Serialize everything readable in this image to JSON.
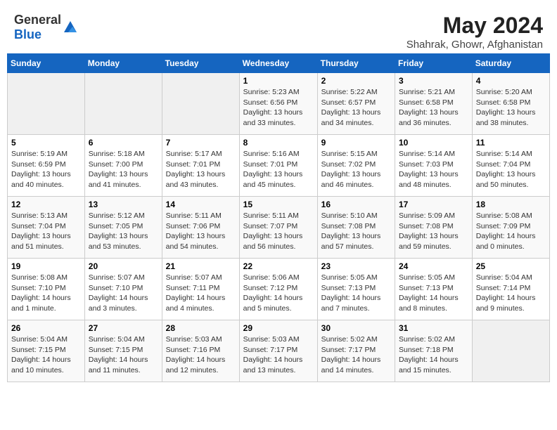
{
  "header": {
    "logo_general": "General",
    "logo_blue": "Blue",
    "month_year": "May 2024",
    "location": "Shahrak, Ghowr, Afghanistan"
  },
  "days_of_week": [
    "Sunday",
    "Monday",
    "Tuesday",
    "Wednesday",
    "Thursday",
    "Friday",
    "Saturday"
  ],
  "weeks": [
    [
      {
        "day": "",
        "sunrise": "",
        "sunset": "",
        "daylight": ""
      },
      {
        "day": "",
        "sunrise": "",
        "sunset": "",
        "daylight": ""
      },
      {
        "day": "",
        "sunrise": "",
        "sunset": "",
        "daylight": ""
      },
      {
        "day": "1",
        "sunrise": "Sunrise: 5:23 AM",
        "sunset": "Sunset: 6:56 PM",
        "daylight": "Daylight: 13 hours and 33 minutes."
      },
      {
        "day": "2",
        "sunrise": "Sunrise: 5:22 AM",
        "sunset": "Sunset: 6:57 PM",
        "daylight": "Daylight: 13 hours and 34 minutes."
      },
      {
        "day": "3",
        "sunrise": "Sunrise: 5:21 AM",
        "sunset": "Sunset: 6:58 PM",
        "daylight": "Daylight: 13 hours and 36 minutes."
      },
      {
        "day": "4",
        "sunrise": "Sunrise: 5:20 AM",
        "sunset": "Sunset: 6:58 PM",
        "daylight": "Daylight: 13 hours and 38 minutes."
      }
    ],
    [
      {
        "day": "5",
        "sunrise": "Sunrise: 5:19 AM",
        "sunset": "Sunset: 6:59 PM",
        "daylight": "Daylight: 13 hours and 40 minutes."
      },
      {
        "day": "6",
        "sunrise": "Sunrise: 5:18 AM",
        "sunset": "Sunset: 7:00 PM",
        "daylight": "Daylight: 13 hours and 41 minutes."
      },
      {
        "day": "7",
        "sunrise": "Sunrise: 5:17 AM",
        "sunset": "Sunset: 7:01 PM",
        "daylight": "Daylight: 13 hours and 43 minutes."
      },
      {
        "day": "8",
        "sunrise": "Sunrise: 5:16 AM",
        "sunset": "Sunset: 7:01 PM",
        "daylight": "Daylight: 13 hours and 45 minutes."
      },
      {
        "day": "9",
        "sunrise": "Sunrise: 5:15 AM",
        "sunset": "Sunset: 7:02 PM",
        "daylight": "Daylight: 13 hours and 46 minutes."
      },
      {
        "day": "10",
        "sunrise": "Sunrise: 5:14 AM",
        "sunset": "Sunset: 7:03 PM",
        "daylight": "Daylight: 13 hours and 48 minutes."
      },
      {
        "day": "11",
        "sunrise": "Sunrise: 5:14 AM",
        "sunset": "Sunset: 7:04 PM",
        "daylight": "Daylight: 13 hours and 50 minutes."
      }
    ],
    [
      {
        "day": "12",
        "sunrise": "Sunrise: 5:13 AM",
        "sunset": "Sunset: 7:04 PM",
        "daylight": "Daylight: 13 hours and 51 minutes."
      },
      {
        "day": "13",
        "sunrise": "Sunrise: 5:12 AM",
        "sunset": "Sunset: 7:05 PM",
        "daylight": "Daylight: 13 hours and 53 minutes."
      },
      {
        "day": "14",
        "sunrise": "Sunrise: 5:11 AM",
        "sunset": "Sunset: 7:06 PM",
        "daylight": "Daylight: 13 hours and 54 minutes."
      },
      {
        "day": "15",
        "sunrise": "Sunrise: 5:11 AM",
        "sunset": "Sunset: 7:07 PM",
        "daylight": "Daylight: 13 hours and 56 minutes."
      },
      {
        "day": "16",
        "sunrise": "Sunrise: 5:10 AM",
        "sunset": "Sunset: 7:08 PM",
        "daylight": "Daylight: 13 hours and 57 minutes."
      },
      {
        "day": "17",
        "sunrise": "Sunrise: 5:09 AM",
        "sunset": "Sunset: 7:08 PM",
        "daylight": "Daylight: 13 hours and 59 minutes."
      },
      {
        "day": "18",
        "sunrise": "Sunrise: 5:08 AM",
        "sunset": "Sunset: 7:09 PM",
        "daylight": "Daylight: 14 hours and 0 minutes."
      }
    ],
    [
      {
        "day": "19",
        "sunrise": "Sunrise: 5:08 AM",
        "sunset": "Sunset: 7:10 PM",
        "daylight": "Daylight: 14 hours and 1 minute."
      },
      {
        "day": "20",
        "sunrise": "Sunrise: 5:07 AM",
        "sunset": "Sunset: 7:10 PM",
        "daylight": "Daylight: 14 hours and 3 minutes."
      },
      {
        "day": "21",
        "sunrise": "Sunrise: 5:07 AM",
        "sunset": "Sunset: 7:11 PM",
        "daylight": "Daylight: 14 hours and 4 minutes."
      },
      {
        "day": "22",
        "sunrise": "Sunrise: 5:06 AM",
        "sunset": "Sunset: 7:12 PM",
        "daylight": "Daylight: 14 hours and 5 minutes."
      },
      {
        "day": "23",
        "sunrise": "Sunrise: 5:05 AM",
        "sunset": "Sunset: 7:13 PM",
        "daylight": "Daylight: 14 hours and 7 minutes."
      },
      {
        "day": "24",
        "sunrise": "Sunrise: 5:05 AM",
        "sunset": "Sunset: 7:13 PM",
        "daylight": "Daylight: 14 hours and 8 minutes."
      },
      {
        "day": "25",
        "sunrise": "Sunrise: 5:04 AM",
        "sunset": "Sunset: 7:14 PM",
        "daylight": "Daylight: 14 hours and 9 minutes."
      }
    ],
    [
      {
        "day": "26",
        "sunrise": "Sunrise: 5:04 AM",
        "sunset": "Sunset: 7:15 PM",
        "daylight": "Daylight: 14 hours and 10 minutes."
      },
      {
        "day": "27",
        "sunrise": "Sunrise: 5:04 AM",
        "sunset": "Sunset: 7:15 PM",
        "daylight": "Daylight: 14 hours and 11 minutes."
      },
      {
        "day": "28",
        "sunrise": "Sunrise: 5:03 AM",
        "sunset": "Sunset: 7:16 PM",
        "daylight": "Daylight: 14 hours and 12 minutes."
      },
      {
        "day": "29",
        "sunrise": "Sunrise: 5:03 AM",
        "sunset": "Sunset: 7:17 PM",
        "daylight": "Daylight: 14 hours and 13 minutes."
      },
      {
        "day": "30",
        "sunrise": "Sunrise: 5:02 AM",
        "sunset": "Sunset: 7:17 PM",
        "daylight": "Daylight: 14 hours and 14 minutes."
      },
      {
        "day": "31",
        "sunrise": "Sunrise: 5:02 AM",
        "sunset": "Sunset: 7:18 PM",
        "daylight": "Daylight: 14 hours and 15 minutes."
      },
      {
        "day": "",
        "sunrise": "",
        "sunset": "",
        "daylight": ""
      }
    ]
  ]
}
